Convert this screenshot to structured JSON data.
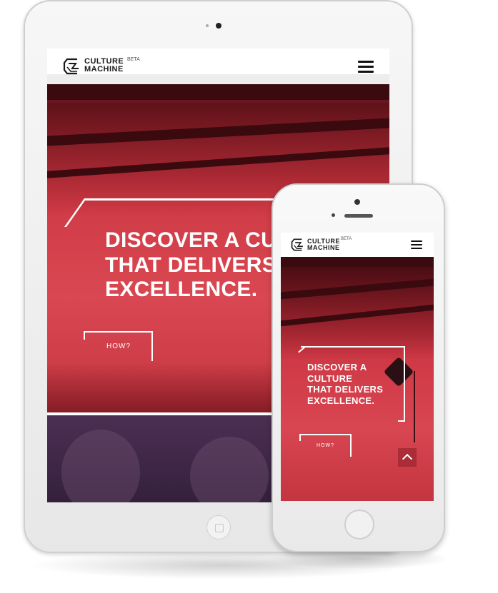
{
  "brand": {
    "name_line1": "CULTURE",
    "name_line2": "MACHINE",
    "badge": "BETA",
    "logo_icon": "culture-machine-logo-icon"
  },
  "nav": {
    "menu_icon": "hamburger-menu-icon"
  },
  "tablet": {
    "hero": {
      "headline_line1": "DISCOVER A CULTU",
      "headline_line2": "THAT DELIVERS",
      "headline_line3": "EXCELLENCE.",
      "cta_label": "HOW?"
    }
  },
  "phone": {
    "hero": {
      "headline_line1": "DISCOVER A",
      "headline_line2": "CULTURE",
      "headline_line3": "THAT DELIVERS",
      "headline_line4": "EXCELLENCE.",
      "cta_label": "HOW?",
      "scroll_icon": "chevron-up-icon"
    }
  },
  "colors": {
    "hero_red": "#d94852",
    "dark_purple": "#3e2647",
    "white": "#ffffff"
  }
}
